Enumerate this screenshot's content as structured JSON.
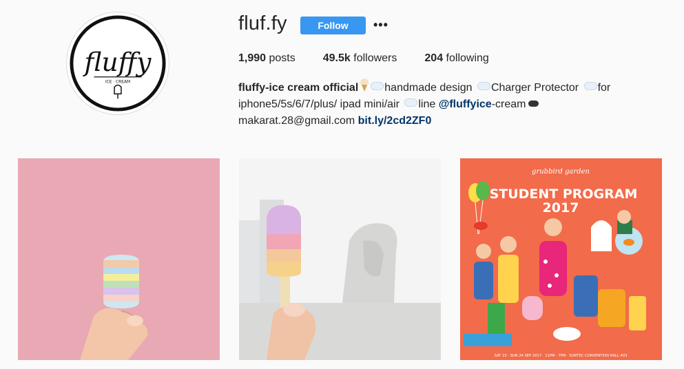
{
  "profile": {
    "username": "fluf.fy",
    "follow_label": "Follow",
    "more_label": "•••",
    "avatar": {
      "logo_text": "fluffy",
      "logo_subtext": "ICE · CREAM"
    }
  },
  "stats": {
    "posts_count": "1,990",
    "posts_label": "posts",
    "followers_count": "49.5k",
    "followers_label": "followers",
    "following_count": "204",
    "following_label": "following"
  },
  "bio": {
    "name": "fluffy-ice cream official",
    "part1": "handmade design",
    "part2": "Charger Protector",
    "part3": "for iphone5/5s/6/7/plus/ ipad mini/air",
    "part4": "line",
    "mention": "@fluffyice",
    "mention_suffix": "-cream",
    "email": "makarat.28@gmail.com",
    "link": "bit.ly/2cd2ZF0",
    "icons": [
      "ice-cream-cone-icon",
      "cloud-icon",
      "cloud-icon",
      "cloud-icon",
      "cloud-icon",
      "dark-cloud-icon"
    ]
  },
  "posts": [
    {
      "description": "rainbow-popsicle-pink-background"
    },
    {
      "description": "popsicle-merlion"
    },
    {
      "poster_title_line1": "STUDENT PROGRAM",
      "poster_title_line2": "2017",
      "poster_brand": "grubbird garden",
      "poster_footer": "SAT 23 - SUN 24 SEP 2017 · 11PM - 7PM · SUNTEC CONVENTION HALL 403"
    }
  ],
  "colors": {
    "follow_button": "#3897f0",
    "link": "#003569",
    "poster_background": "#f26b4a",
    "post1_background": "#e8a9b4"
  }
}
